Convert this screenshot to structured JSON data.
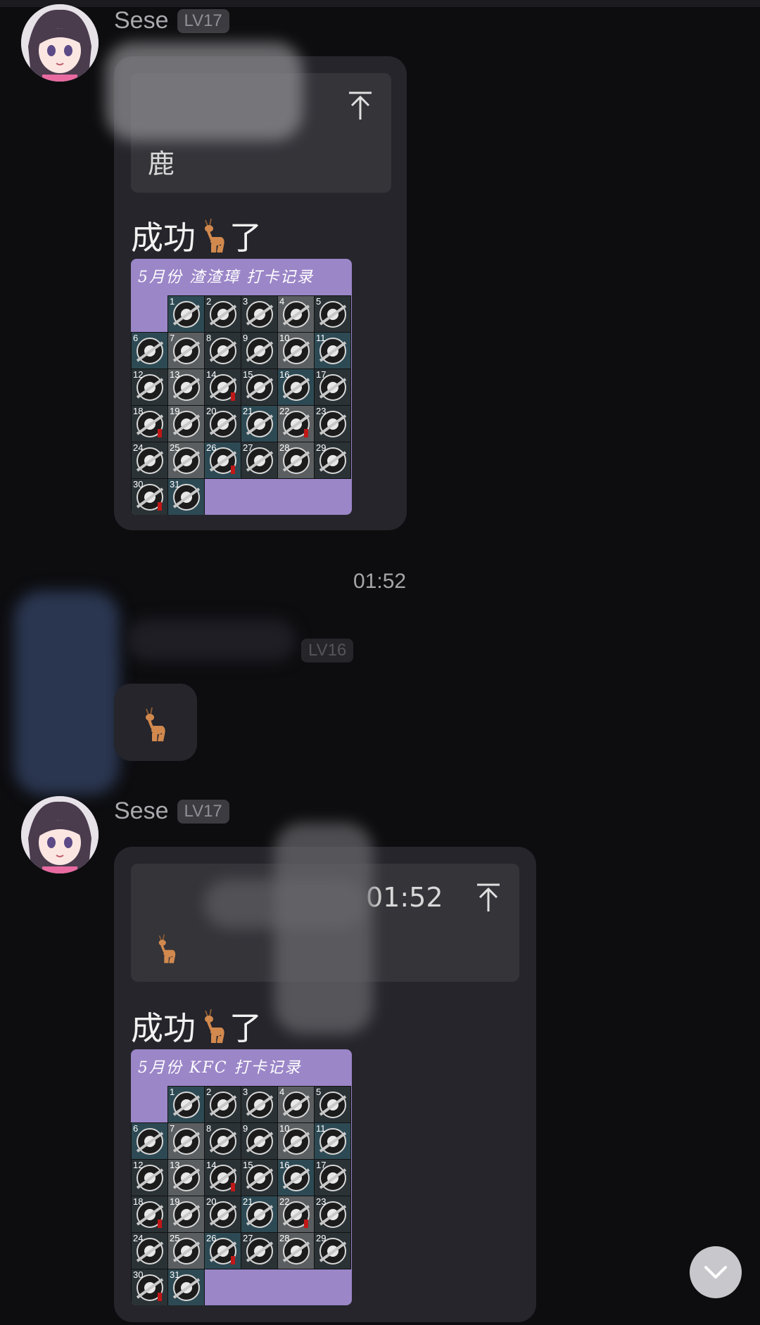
{
  "messages": [
    {
      "sender": "Sese",
      "level": "LV17",
      "quote_text": "鹿",
      "text_before": "成功",
      "text_after": "了",
      "card": {
        "title": "5月份 渣渣璋 打卡记录",
        "days": [
          "1",
          "2",
          "3",
          "4",
          "5",
          "6",
          "7",
          "8",
          "9",
          "10",
          "11",
          "12",
          "13",
          "14",
          "15",
          "16",
          "17",
          "18",
          "19",
          "20",
          "21",
          "22",
          "23",
          "24",
          "25",
          "26",
          "27",
          "28",
          "29",
          "30",
          "31"
        ]
      }
    },
    {
      "timestamp": "01:52",
      "level_partial": "LV16"
    },
    {
      "sender": "Sese",
      "level": "LV17",
      "quote_time": "01:52",
      "text_before": "成功",
      "text_after": "了",
      "card": {
        "title": "5月份 KFC 打卡记录",
        "days": [
          "1",
          "2",
          "3",
          "4",
          "5",
          "6",
          "7",
          "8",
          "9",
          "10",
          "11",
          "12",
          "13",
          "14",
          "15",
          "16",
          "17",
          "18",
          "19",
          "20",
          "21",
          "22",
          "23",
          "24",
          "25",
          "26",
          "27",
          "28",
          "29",
          "30",
          "31"
        ]
      }
    }
  ],
  "icons": {
    "pin": "jump-to-top-icon",
    "deer": "deer-emoji",
    "scroll": "chevron-down-icon"
  },
  "colors": {
    "background": "#0d0d10",
    "bubble": "#25252b",
    "quote": "#343439",
    "card": "#9b86c8"
  }
}
